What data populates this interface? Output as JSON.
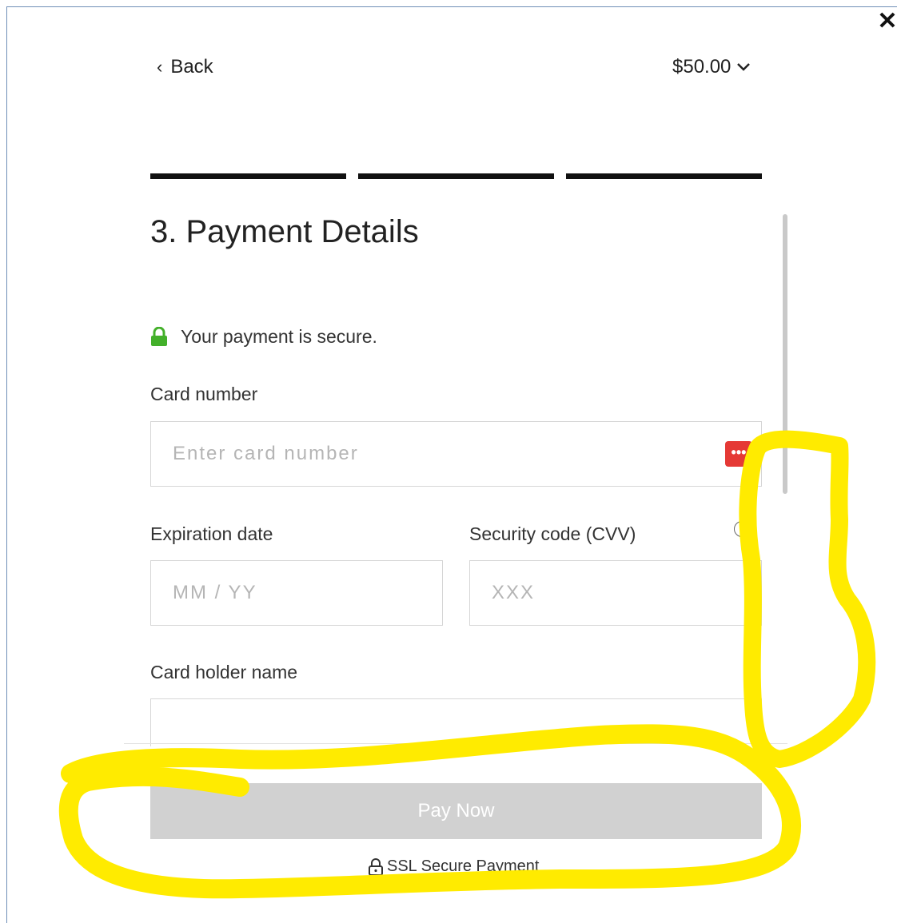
{
  "header": {
    "back_label": "Back",
    "amount": "$50.00",
    "close_glyph": "✕"
  },
  "steps": {
    "total": 3,
    "completed": 3
  },
  "form": {
    "title": "3. Payment Details",
    "secure_note": "Your payment is secure.",
    "card_number": {
      "label": "Card number",
      "placeholder": "Enter card number",
      "value": ""
    },
    "expiration": {
      "label": "Expiration date",
      "placeholder": "MM / YY",
      "value": ""
    },
    "cvv": {
      "label": "Security code (CVV)",
      "placeholder": "XXX",
      "value": ""
    },
    "holder": {
      "label": "Card holder name",
      "placeholder": "",
      "value": ""
    }
  },
  "footer": {
    "pay_label": "Pay Now",
    "ssl_label": "SSL Secure Payment"
  },
  "icons": {
    "card_brand_icon": "credit-card-icon",
    "info_icon": "info-icon",
    "secure_icon": "padlock-icon"
  },
  "colors": {
    "secure_green": "#43b02a",
    "card_icon_red": "#e53935",
    "button_disabled": "#d1d1d1",
    "annotation_yellow": "#ffeb00"
  }
}
